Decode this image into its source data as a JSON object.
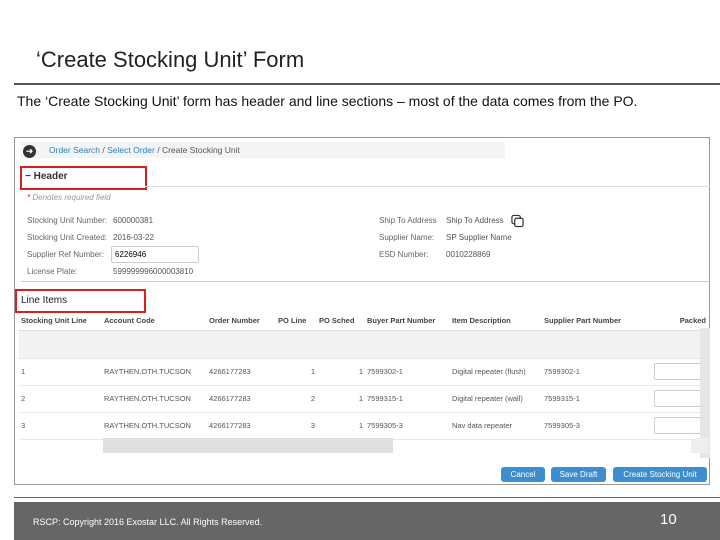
{
  "slide": {
    "title": "‘Create Stocking Unit’ Form",
    "description": "The ‘Create Stocking Unit’ form has header and line sections – most of the data comes from the PO.",
    "footer": "RSCP:  Copyright 2016 Exostar LLC. All Rights Reserved.",
    "page_number": "10"
  },
  "breadcrumb": {
    "item1": "Order Search",
    "sep": " / ",
    "item2": "Select Order",
    "current": "Create Stocking Unit"
  },
  "header": {
    "title": "Header",
    "required_note": "Denotes required field",
    "fields": [
      {
        "label": "Stocking Unit Number:",
        "value": "600000381"
      },
      {
        "label": "Stocking Unit Created:",
        "value": "2016-03-22"
      },
      {
        "label": "Supplier Ref Number:",
        "value": "6226946"
      },
      {
        "label": "License Plate:",
        "value": "599999996000003810"
      },
      {
        "label": "Ship To Address",
        "value": "Ship To Address"
      },
      {
        "label": "Supplier Name:",
        "value": "SP Supplier Name"
      },
      {
        "label": "ESD Number:",
        "value": "0010228869"
      }
    ]
  },
  "line_items": {
    "title": "Line Items",
    "columns": [
      "Stocking Unit Line",
      "Account Code",
      "Order Number",
      "PO Line",
      "PO Sched",
      "Buyer Part Number",
      "Item Description",
      "Supplier Part Number",
      "Packed"
    ],
    "rows": [
      [
        "1",
        "RAYTHEN.OTH.TUCSON",
        "4266177283",
        "1",
        "1",
        "7599302-1",
        "Digital repeater (flush)",
        "7599302-1"
      ],
      [
        "2",
        "RAYTHEN.OTH.TUCSON",
        "4266177283",
        "2",
        "1",
        "7599315-1",
        "Digital repeater (wall)",
        "7599315-1"
      ],
      [
        "3",
        "RAYTHEN.OTH.TUCSON",
        "4266177283",
        "3",
        "1",
        "7599305-3",
        "Nav data repeater",
        "7599305-3"
      ]
    ]
  },
  "buttons": {
    "cancel": "Cancel",
    "save_draft": "Save Draft",
    "create": "Create Stocking Unit"
  }
}
